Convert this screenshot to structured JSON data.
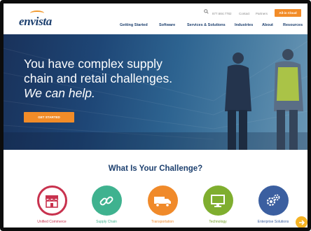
{
  "header": {
    "logo": "envista",
    "phone": "877.684.7782",
    "contact": "Contact",
    "partners": "Partners",
    "cta": "All-in Cloud",
    "nav": [
      "Getting Started",
      "Software",
      "Services & Solutions",
      "Industries",
      "About",
      "Resources"
    ]
  },
  "hero": {
    "line1": "You have complex supply",
    "line2": "chain and retail challenges.",
    "line3": "We can help.",
    "button": "GET STARTED"
  },
  "challenge": {
    "title": "What Is Your Challenge?",
    "items": [
      {
        "label": "Unified Commerce",
        "icon": "storefront-icon",
        "color": "#c8324e",
        "label_color": "#c8324e"
      },
      {
        "label": "Supply Chain",
        "icon": "chain-link-icon",
        "color": "#3fb28f",
        "label_color": "#3fb28f"
      },
      {
        "label": "Transportation",
        "icon": "truck-icon",
        "color": "#f08a2a",
        "label_color": "#f08a2a"
      },
      {
        "label": "Technology",
        "icon": "monitor-icon",
        "color": "#7fae2f",
        "label_color": "#6f9e22"
      },
      {
        "label": "Enterprise Solutions",
        "icon": "gears-icon",
        "color": "#3b5fa0",
        "label_color": "#3b5fa0"
      }
    ]
  },
  "colors": {
    "brand_navy": "#1c3f6e",
    "accent_orange": "#f28c28"
  }
}
